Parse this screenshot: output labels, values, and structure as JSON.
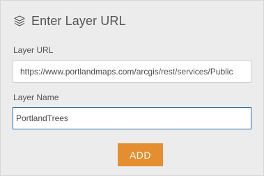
{
  "panel": {
    "title": "Enter Layer URL",
    "title_icon": "layers-icon"
  },
  "form": {
    "url_label": "Layer URL",
    "url_value": "https://www.portlandmaps.com/arcgis/rest/services/Public",
    "name_label": "Layer Name",
    "name_value": "PortlandTrees",
    "add_label": "ADD"
  },
  "colors": {
    "background": "#ececec",
    "accent_button": "#e58e30",
    "focus_border": "#2b6fa3",
    "text": "#555555"
  }
}
